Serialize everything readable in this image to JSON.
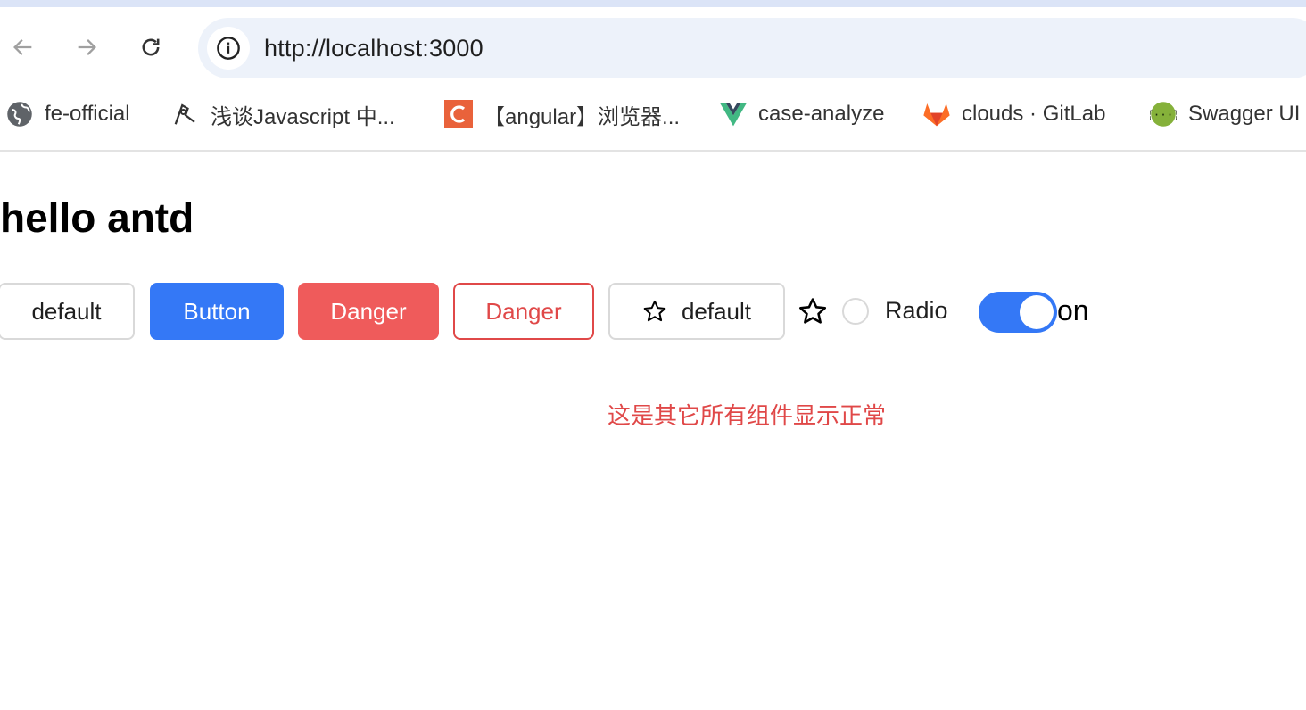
{
  "browser": {
    "url": "http://localhost:3000",
    "bookmarks": [
      {
        "label": "fe-official",
        "icon": "globe-icon"
      },
      {
        "label": "浅谈Javascript 中...",
        "icon": "pen-nib-icon"
      },
      {
        "label": "【angular】浏览器...",
        "icon": "c-logo-icon"
      },
      {
        "label": "case-analyze",
        "icon": "vue-logo-icon"
      },
      {
        "label": "clouds · GitLab",
        "icon": "gitlab-logo-icon"
      },
      {
        "label": "Swagger UI",
        "icon": "swagger-logo-icon"
      }
    ]
  },
  "page": {
    "title": "hello antd",
    "buttons": {
      "default": "default",
      "primary": "Button",
      "danger": "Danger",
      "danger_ghost": "Danger",
      "icon_default": "default"
    },
    "radio_label": "Radio",
    "switch_label": "on",
    "switch_checked": true,
    "note": "这是其它所有组件显示正常"
  },
  "colors": {
    "primary": "#3478f6",
    "danger": "#ef5b5b",
    "danger_text": "#e04848",
    "omnibox_bg": "#edf2fa"
  }
}
